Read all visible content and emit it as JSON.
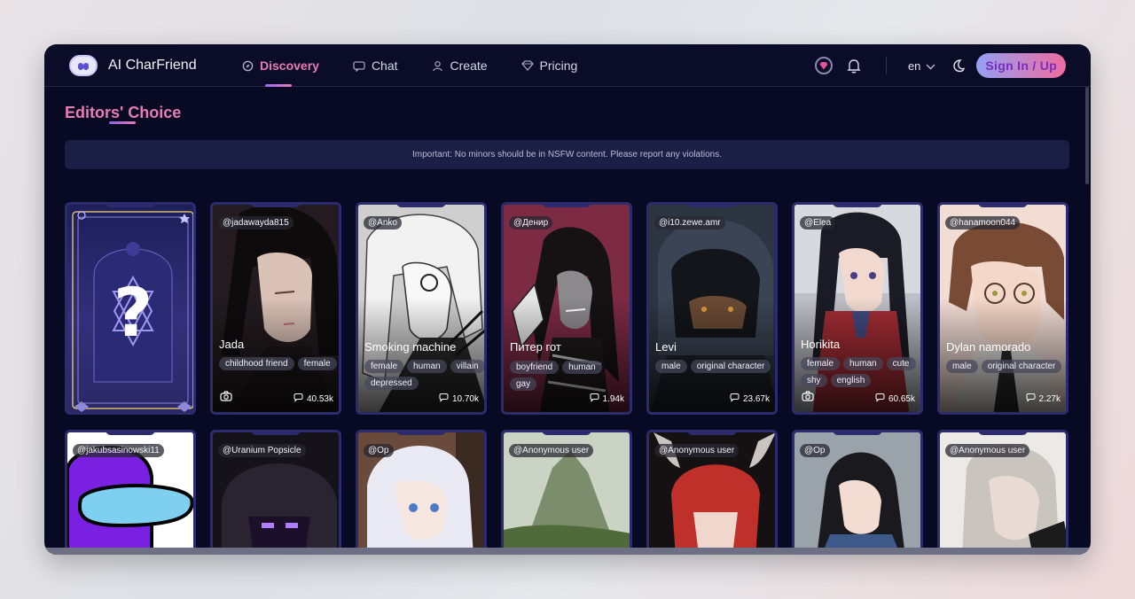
{
  "app": {
    "name": "AI CharFriend"
  },
  "nav": {
    "items": [
      {
        "label": "Discovery",
        "icon": "compass-icon",
        "active": true
      },
      {
        "label": "Chat",
        "icon": "chat-icon",
        "active": false
      },
      {
        "label": "Create",
        "icon": "user-icon",
        "active": false
      },
      {
        "label": "Pricing",
        "icon": "diamond-icon",
        "active": false
      }
    ],
    "language": "en",
    "signin_label": "Sign In / Up"
  },
  "section": {
    "title": "Editors' Choice",
    "notice": "Important: No minors should be in NSFW content. Please report any violations."
  },
  "cards_row1": [
    {
      "handle": "",
      "name": "",
      "tags": [],
      "count": ""
    },
    {
      "handle": "@jadawayda815",
      "name": "Jada",
      "tags": [
        "childhood friend",
        "female"
      ],
      "count": "40.53k",
      "camera": true
    },
    {
      "handle": "@Anko",
      "name": "Smoking machine",
      "tags": [
        "female",
        "human",
        "villain",
        "depressed"
      ],
      "count": "10.70k"
    },
    {
      "handle": "@Денир",
      "name": "Питер гот",
      "tags": [
        "boyfriend",
        "human",
        "gay"
      ],
      "count": "1.94k"
    },
    {
      "handle": "@i10.zewe.amr",
      "name": "Levi",
      "tags": [
        "male",
        "original character"
      ],
      "count": "23.67k"
    },
    {
      "handle": "@Elea",
      "name": "Horikita",
      "tags": [
        "female",
        "human",
        "cute",
        "shy",
        "english"
      ],
      "count": "60.65k",
      "camera": true
    },
    {
      "handle": "@hanamoon044",
      "name": "Dylan namorado",
      "tags": [
        "male",
        "original character"
      ],
      "count": "2.27k"
    }
  ],
  "cards_row2": [
    {
      "handle": "@jakubsasinowski11"
    },
    {
      "handle": "@Uranium Popsicle"
    },
    {
      "handle": "@Op"
    },
    {
      "handle": "@Anonymous user"
    },
    {
      "handle": "@Anonymous user"
    },
    {
      "handle": "@Op"
    },
    {
      "handle": "@Anonymous user"
    }
  ],
  "colors": {
    "background": "#080a24",
    "accent_pink": "#ea7bb7",
    "accent_purple": "#9b6cf2",
    "card_border": "#2c2b6e"
  }
}
